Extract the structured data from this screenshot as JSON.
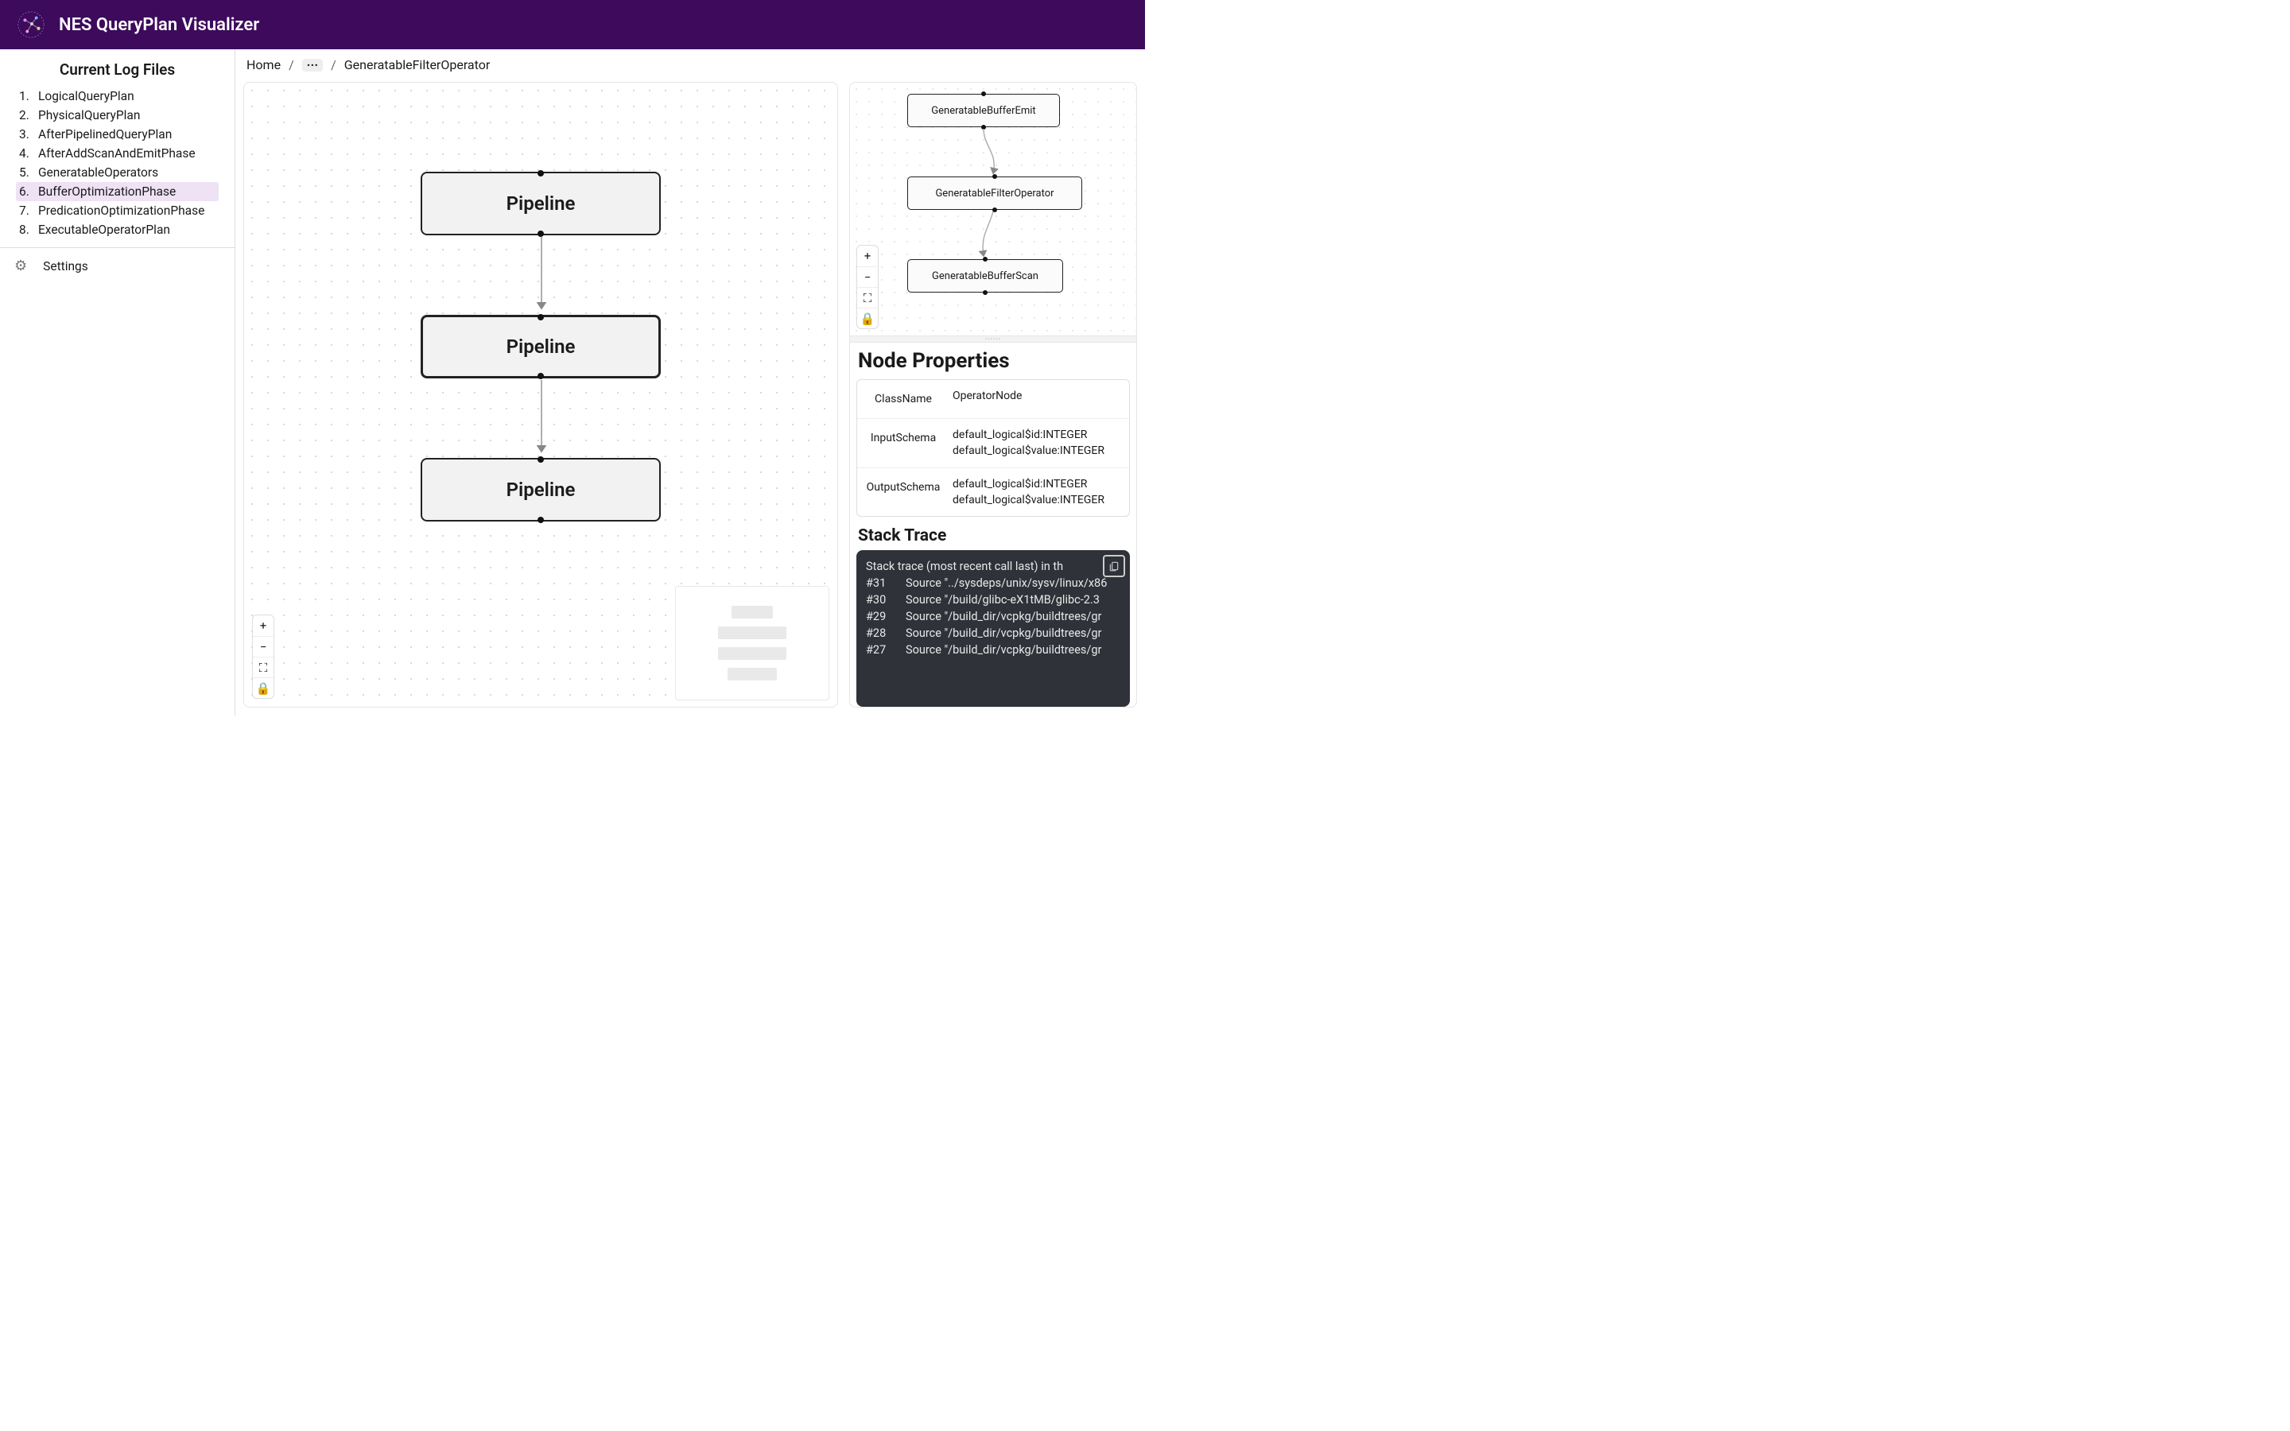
{
  "header": {
    "title": "NES QueryPlan Visualizer"
  },
  "sidebar": {
    "title": "Current Log Files",
    "items": [
      {
        "num": "1.",
        "label": "LogicalQueryPlan"
      },
      {
        "num": "2.",
        "label": "PhysicalQueryPlan"
      },
      {
        "num": "3.",
        "label": "AfterPipelinedQueryPlan"
      },
      {
        "num": "4.",
        "label": "AfterAddScanAndEmitPhase"
      },
      {
        "num": "5.",
        "label": "GeneratableOperators"
      },
      {
        "num": "6.",
        "label": "BufferOptimizationPhase"
      },
      {
        "num": "7.",
        "label": "PredicationOptimizationPhase"
      },
      {
        "num": "8.",
        "label": "ExecutableOperatorPlan"
      }
    ],
    "selectedIndex": 5,
    "settings": "Settings"
  },
  "breadcrumb": {
    "home": "Home",
    "ellipsis": "···",
    "current": "GeneratableFilterOperator"
  },
  "mainGraph": {
    "nodes": [
      {
        "label": "Pipeline"
      },
      {
        "label": "Pipeline"
      },
      {
        "label": "Pipeline"
      }
    ]
  },
  "miniGraph": {
    "nodes": [
      {
        "label": "GeneratableBufferEmit"
      },
      {
        "label": "GeneratableFilterOperator"
      },
      {
        "label": "GeneratableBufferScan"
      }
    ]
  },
  "controls": {
    "zoomIn": "+",
    "zoomOut": "−",
    "fit": "⛶",
    "lock": "🔒"
  },
  "properties": {
    "title": "Node Properties",
    "rows": [
      {
        "key": "ClassName",
        "val": "OperatorNode"
      },
      {
        "key": "InputSchema",
        "val": "default_logical$id:INTEGER\ndefault_logical$value:INTEGER"
      },
      {
        "key": "OutputSchema",
        "val": "default_logical$id:INTEGER\ndefault_logical$value:INTEGER"
      }
    ]
  },
  "stackTrace": {
    "title": "Stack Trace",
    "header": "Stack trace (most recent call last) in th",
    "frames": [
      {
        "idx": "#31",
        "src": "Source \"../sysdeps/unix/sysv/linux/x86"
      },
      {
        "idx": "#30",
        "src": "Source \"/build/glibc-eX1tMB/glibc-2.3"
      },
      {
        "idx": "#29",
        "src": "Source \"/build_dir/vcpkg/buildtrees/gr"
      },
      {
        "idx": "#28",
        "src": "Source \"/build_dir/vcpkg/buildtrees/gr"
      },
      {
        "idx": "#27",
        "src": "Source \"/build_dir/vcpkg/buildtrees/gr"
      }
    ]
  }
}
